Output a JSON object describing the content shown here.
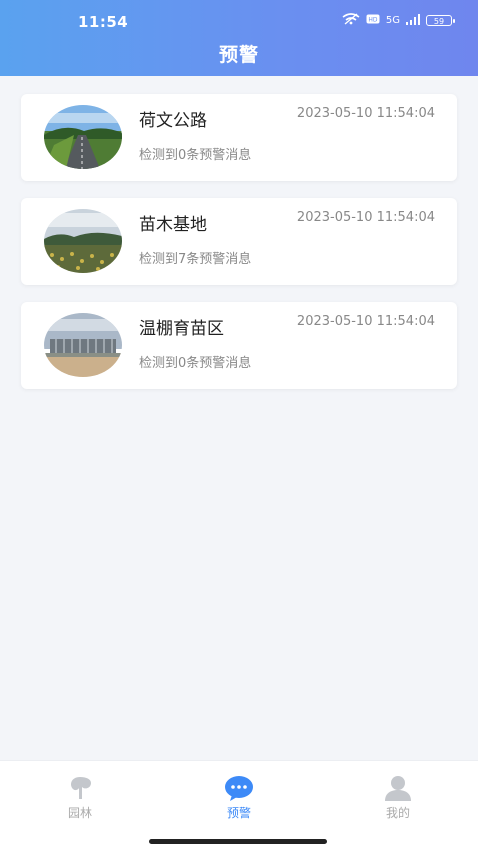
{
  "status_bar": {
    "time": "11:54",
    "network": "5G",
    "battery": "59"
  },
  "header": {
    "title": "预警"
  },
  "alerts": [
    {
      "name": "荷文公路",
      "time": "2023-05-10 11:54:04",
      "message": "检测到0条预警消息",
      "image": "road-photo"
    },
    {
      "name": "苗木基地",
      "time": "2023-05-10 11:54:04",
      "message": "检测到7条预警消息",
      "image": "nursery-photo"
    },
    {
      "name": "温棚育苗区",
      "time": "2023-05-10 11:54:04",
      "message": "检测到0条预警消息",
      "image": "greenhouse-photo"
    }
  ],
  "tabbar": {
    "items": [
      {
        "label": "园林",
        "icon": "tree-icon",
        "active": false
      },
      {
        "label": "预警",
        "icon": "chat-bubble-icon",
        "active": true
      },
      {
        "label": "我的",
        "icon": "user-icon",
        "active": false
      }
    ],
    "active_color": "#3d8af7",
    "inactive_color": "#aaaaaa"
  },
  "colors": {
    "header_start": "#5aa2ef",
    "header_end": "#6f86ee",
    "background": "#f3f5f9"
  }
}
